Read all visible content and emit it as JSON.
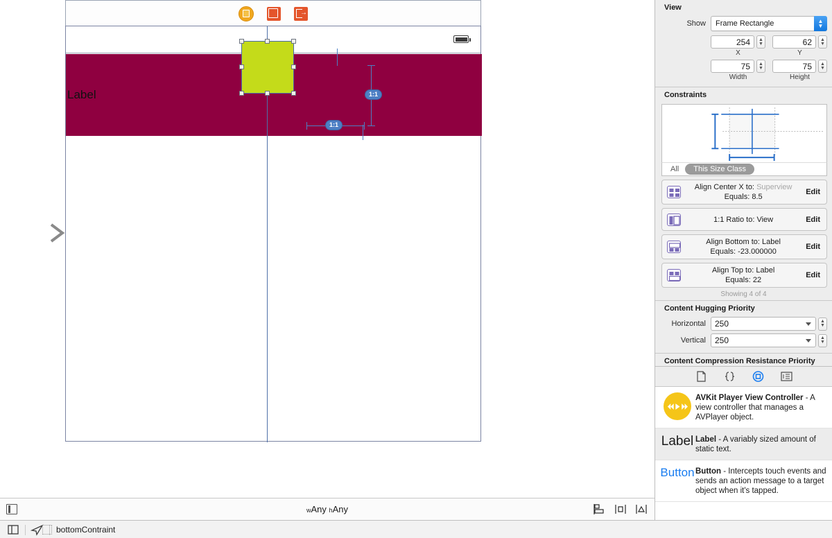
{
  "canvas": {
    "scene_icons": [
      {
        "name": "view-controller-icon",
        "label": "View Controller"
      },
      {
        "name": "first-responder-icon",
        "label": "First Responder"
      },
      {
        "name": "exit-icon",
        "label": "Exit"
      }
    ],
    "label_text": "Label",
    "label_view_color": "#8f0040",
    "selected_view_color": "#c4db1a",
    "ratio_badge_right": "1:1",
    "ratio_badge_bottom": "1:1",
    "size_class_prefix_w": "w",
    "size_class_w": "Any",
    "size_class_prefix_h": "h",
    "size_class_h": "Any"
  },
  "inspector": {
    "view_section_title": "View",
    "show_label": "Show",
    "show_value": "Frame Rectangle",
    "x_value": "254",
    "x_caption": "X",
    "y_value": "62",
    "y_caption": "Y",
    "width_value": "75",
    "width_caption": "Width",
    "height_value": "75",
    "height_caption": "Height",
    "constraints_title": "Constraints",
    "seg_all": "All",
    "seg_this_size_class": "This Size Class",
    "constraints": [
      {
        "icon": "align-center-x-icon",
        "line1_label": "Align Center X to:",
        "line1_value": "Superview",
        "line1_value_dim": true,
        "line2_label": "Equals:",
        "line2_value": "8.5",
        "edit": "Edit"
      },
      {
        "icon": "ratio-icon",
        "line1_label": "1:1 Ratio to:",
        "line1_value": "View",
        "line1_value_dim": false,
        "line2_label": "",
        "line2_value": "",
        "edit": "Edit"
      },
      {
        "icon": "align-bottom-icon",
        "line1_label": "Align Bottom to:",
        "line1_value": "Label",
        "line1_value_dim": false,
        "line2_label": "Equals:",
        "line2_value": "-23.000000",
        "edit": "Edit"
      },
      {
        "icon": "align-top-icon",
        "line1_label": "Align Top to:",
        "line1_value": "Label",
        "line1_value_dim": false,
        "line2_label": "Equals:",
        "line2_value": "22",
        "edit": "Edit"
      }
    ],
    "showing_text": "Showing 4 of 4",
    "chp_title": "Content Hugging Priority",
    "chp_horizontal_label": "Horizontal",
    "chp_horizontal_value": "250",
    "chp_vertical_label": "Vertical",
    "chp_vertical_value": "250",
    "ccrp_title": "Content Compression Resistance Priority"
  },
  "library": {
    "tabs": [
      {
        "name": "file-template-library-tab",
        "selected": false
      },
      {
        "name": "code-snippet-library-tab",
        "selected": false
      },
      {
        "name": "object-library-tab",
        "selected": true
      },
      {
        "name": "media-library-tab",
        "selected": false
      }
    ],
    "items": [
      {
        "thumb": "avkit-player-icon",
        "title": "AVKit Player View Controller",
        "desc": " - A view controller that manages a AVPlayer object."
      },
      {
        "thumb": "label-thumb",
        "thumb_text": "Label",
        "title": "Label",
        "desc": " - A variably sized amount of static text."
      },
      {
        "thumb": "button-thumb",
        "thumb_text": "Button",
        "title": "Button",
        "desc": " - Intercepts touch events and sends an action message to a target object when it's tapped."
      }
    ],
    "search_placeholder": ""
  },
  "status_bar": {
    "breadcrumb": "bottomContraint"
  }
}
